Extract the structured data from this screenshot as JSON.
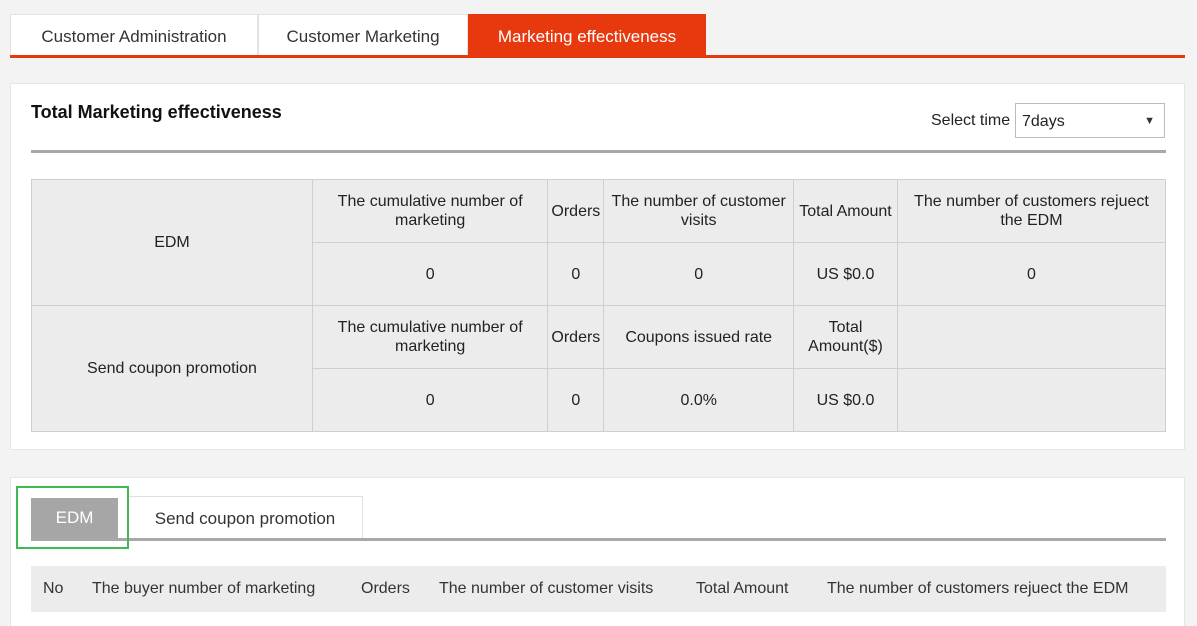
{
  "top_tabs": [
    {
      "label": "Customer Administration",
      "active": false
    },
    {
      "label": "Customer Marketing",
      "active": false
    },
    {
      "label": "Marketing effectiveness",
      "active": true
    }
  ],
  "accent_color": "#e8380d",
  "summary": {
    "title": "Total Marketing effectiveness",
    "select_label": "Select time",
    "select_value": "7days",
    "edm": {
      "label": "EDM",
      "headers": [
        "The cumulative number of marketing",
        "Orders",
        "The number of customer visits",
        "Total Amount",
        "The number of customers rejuect the EDM"
      ],
      "values": [
        "0",
        "0",
        "0",
        "US $0.0",
        "0"
      ]
    },
    "coupon": {
      "label": "Send coupon promotion",
      "headers": [
        "The cumulative number of marketing",
        "Orders",
        "Coupons issued rate",
        "Total Amount($)",
        ""
      ],
      "values": [
        "0",
        "0",
        "0.0%",
        "US $0.0",
        ""
      ]
    }
  },
  "detail": {
    "tabs": [
      {
        "label": "EDM",
        "active": true
      },
      {
        "label": "Send coupon promotion",
        "active": false
      }
    ],
    "columns": [
      "No",
      "The buyer number of marketing",
      "Orders",
      "The number of customer visits",
      "Total Amount",
      "The number of customers rejuect the EDM"
    ]
  }
}
